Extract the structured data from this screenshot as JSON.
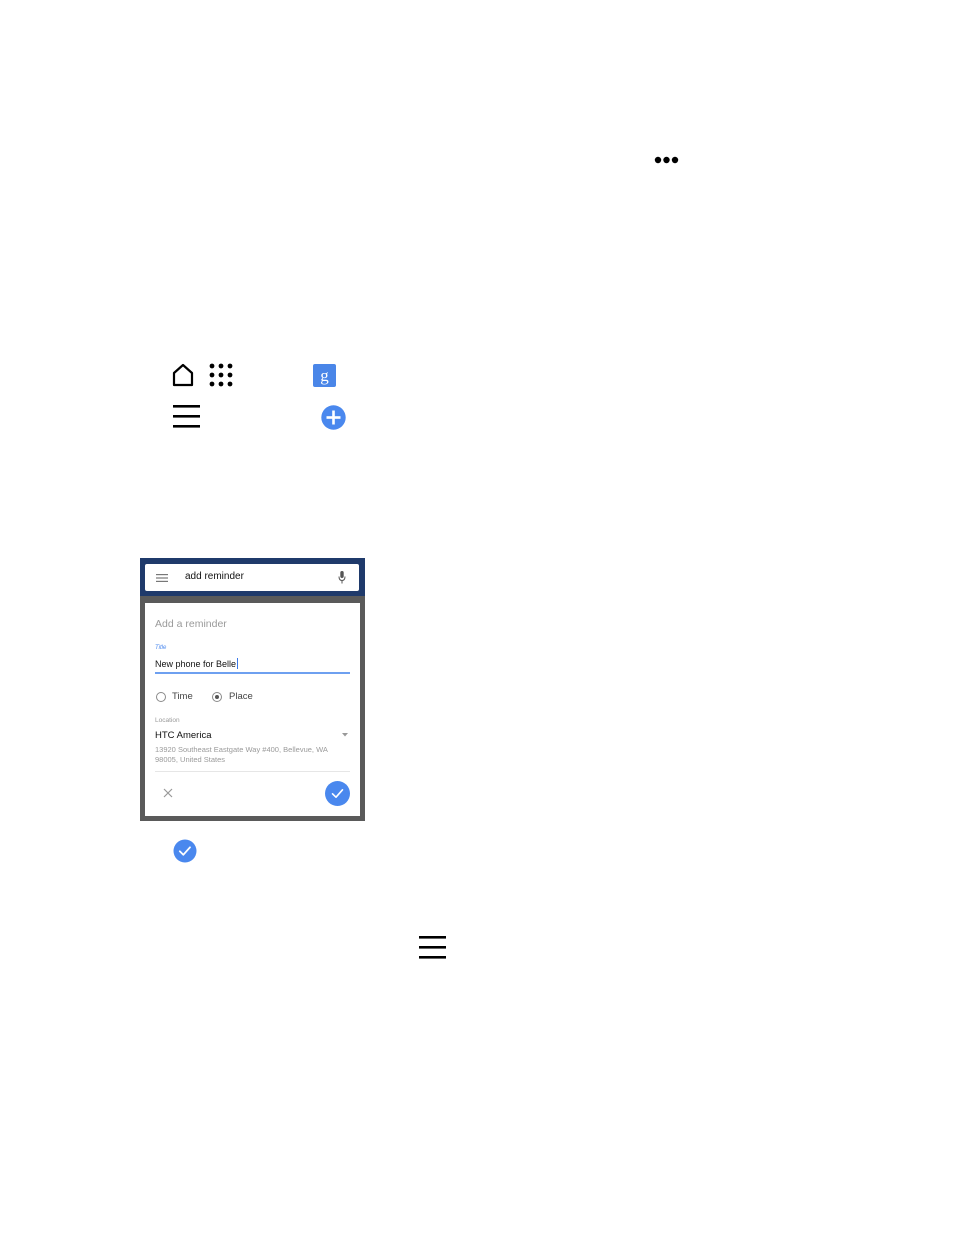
{
  "icons": {
    "more": "more-dots-icon",
    "home": "home-icon",
    "apps": "apps-grid-icon",
    "google": "google-search-icon",
    "menu": "menu-icon",
    "add": "add-circle-icon",
    "done": "check-circle-icon",
    "menu_secondary": "menu-icon"
  },
  "colors": {
    "accent": "#4a88ee",
    "google_blue": "#4a86e8",
    "phone_header": "#1f3a6b"
  },
  "phone": {
    "search": {
      "query": "add reminder"
    },
    "reminder_card": {
      "heading": "Add a reminder",
      "title_label": "Title",
      "title_value": "New phone for Belle",
      "options": [
        {
          "label": "Time",
          "selected": false
        },
        {
          "label": "Place",
          "selected": true
        }
      ],
      "location_label": "Location",
      "location_name": "HTC America",
      "location_address": "13920 Southeast Eastgate Way #400, Bellevue, WA 98005, United States"
    }
  }
}
